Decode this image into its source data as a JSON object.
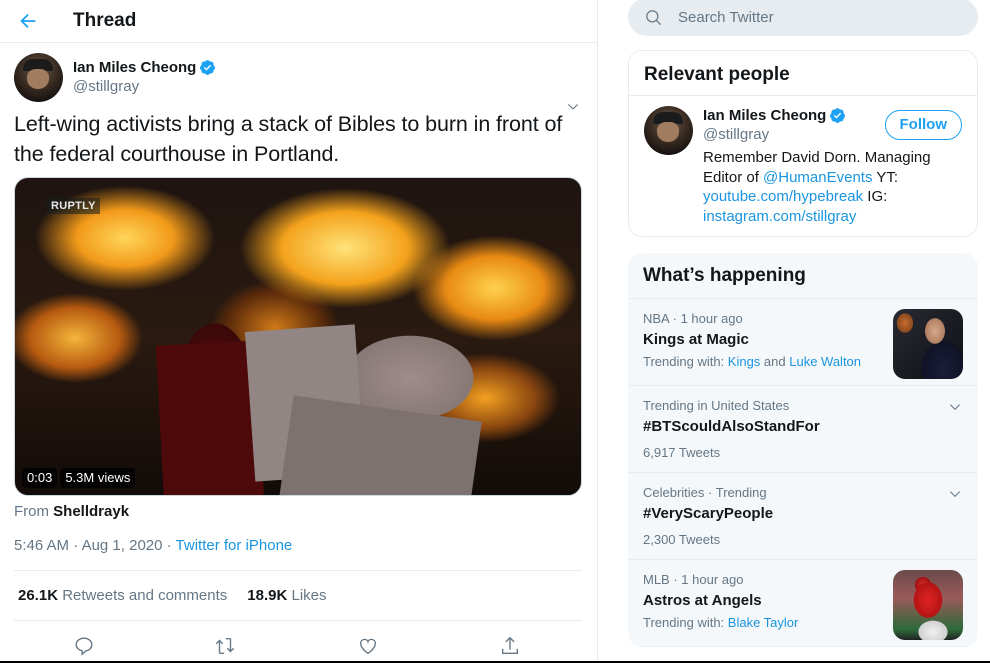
{
  "header": {
    "title": "Thread",
    "back_icon": "arrow-left-icon"
  },
  "tweet": {
    "author": {
      "name": "Ian Miles Cheong",
      "handle": "@stillgray",
      "verified": true
    },
    "text": "Left-wing activists bring a stack of Bibles to burn in front of the federal courthouse in Portland.",
    "media": {
      "watermark": "RUPTLY",
      "duration": "0:03",
      "views": "5.3M views"
    },
    "from_prefix": "From",
    "from_source": "Shelldrayk",
    "time": "5:46 AM",
    "date": "Aug 1, 2020",
    "separator": "·",
    "client": "Twitter for iPhone",
    "stats": {
      "retweets_count": "26.1K",
      "retweets_label": "Retweets and comments",
      "likes_count": "18.9K",
      "likes_label": "Likes"
    },
    "actions": [
      "reply-icon",
      "retweet-icon",
      "like-icon",
      "share-icon"
    ]
  },
  "sidebar": {
    "search": {
      "placeholder": "Search Twitter",
      "value": ""
    },
    "relevant_people": {
      "title": "Relevant people",
      "person": {
        "name": "Ian Miles Cheong",
        "handle": "@stillgray",
        "verified": true,
        "follow_label": "Follow",
        "bio": {
          "text1": "Remember David Dorn. Managing Editor of ",
          "mention": "@HumanEvents",
          "text2": " YT: ",
          "link1": "youtube.com/hypebreak",
          "text3": " IG: ",
          "link2": "instagram.com/stillgray"
        }
      }
    },
    "whats_happening": {
      "title": "What’s happening",
      "trends": [
        {
          "context": "NBA · 1 hour ago",
          "name": "Kings at Magic",
          "sub_prefix": "Trending with: ",
          "sub_link1": "Kings",
          "sub_mid": " and ",
          "sub_link2": "Luke Walton",
          "has_image": true
        },
        {
          "context": "Trending in United States",
          "name": "#BTScouldAlsoStandFor",
          "count": "6,917 Tweets",
          "has_caret": true
        },
        {
          "context": "Celebrities · Trending",
          "name": "#VeryScaryPeople",
          "count": "2,300 Tweets",
          "has_caret": true
        },
        {
          "context": "MLB · 1 hour ago",
          "name": "Astros at Angels",
          "sub_prefix": "Trending with: ",
          "sub_link1": "Blake Taylor",
          "has_image": true
        }
      ]
    }
  },
  "colors": {
    "accent": "#1da1f2",
    "link": "#1b95e0",
    "text_primary": "#14171a",
    "text_secondary": "#657786",
    "border": "#e6ecf0",
    "trends_bg": "#f5f8fa"
  }
}
